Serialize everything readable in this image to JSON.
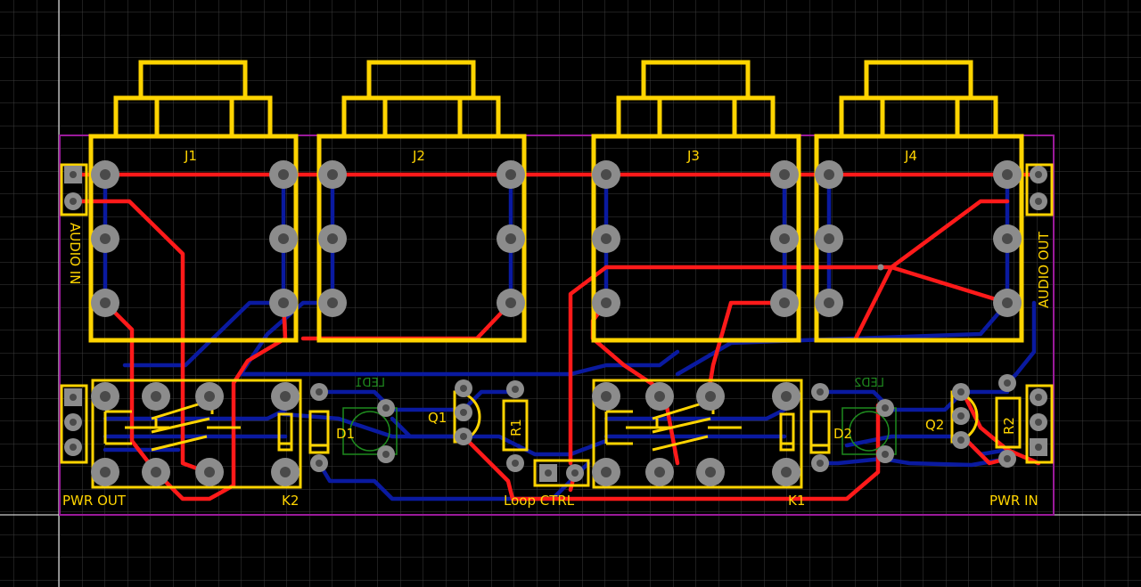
{
  "colors": {
    "background": "#000000",
    "grid": "#3c3c3c",
    "silkscreen": "#ffd400",
    "top_copper": "#ff1a1a",
    "bottom_copper": "#0a1aa0",
    "board_outline": "#9a1a9a",
    "pad": "#8c8c8c",
    "led_silk": "#1e8a1e"
  },
  "labels": {
    "j1": "J1",
    "j2": "J2",
    "j3": "J3",
    "j4": "J4",
    "audio_in": "AUDIO IN",
    "audio_out": "AUDIO OUT",
    "pwr_out": "PWR OUT",
    "pwr_in": "PWR IN",
    "k1": "K1",
    "k2": "K2",
    "d1": "D1",
    "d2": "D2",
    "q1": "Q1",
    "q2": "Q2",
    "r1": "R1",
    "r2": "R2",
    "led1": "LED1",
    "led2": "LED2",
    "loop_ctrl": "Loop CTRL"
  }
}
